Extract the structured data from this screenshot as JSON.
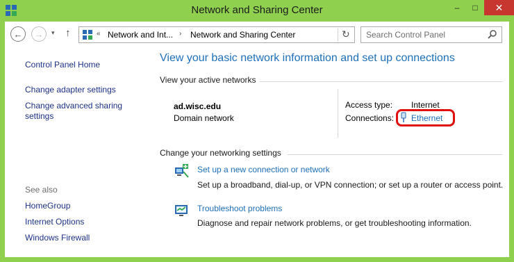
{
  "window": {
    "title": "Network and Sharing Center",
    "controls": {
      "minimize": "–",
      "maximize": "□",
      "close": "✕"
    }
  },
  "nav": {
    "back": "←",
    "forward": "→",
    "recent": "▾",
    "up": "↑",
    "breadcrumbs": [
      "Network and Int...",
      "Network and Sharing Center"
    ],
    "overflow": "«",
    "separator": "›",
    "refresh": "↻",
    "search_placeholder": "Search Control Panel"
  },
  "sidebar": {
    "links": [
      "Control Panel Home",
      "Change adapter settings",
      "Change advanced sharing settings"
    ],
    "see_also_heading": "See also",
    "see_also": [
      "HomeGroup",
      "Internet Options",
      "Windows Firewall"
    ]
  },
  "main": {
    "title": "View your basic network information and set up connections",
    "active_networks_label": "View your active networks",
    "network": {
      "name": "ad.wisc.edu",
      "category": "Domain network",
      "access_type_label": "Access type:",
      "access_type_value": "Internet",
      "connections_label": "Connections:",
      "connection_value": "Ethernet"
    },
    "change_settings_label": "Change your networking settings",
    "tasks": [
      {
        "link": "Set up a new connection or network",
        "desc": "Set up a broadband, dial-up, or VPN connection; or set up a router or access point.",
        "icon": "new-connection-icon"
      },
      {
        "link": "Troubleshoot problems",
        "desc": "Diagnose and repair network problems, or get troubleshooting information.",
        "icon": "troubleshoot-icon"
      }
    ]
  },
  "colors": {
    "frame": "#8fd14f",
    "link": "#1e6fb8",
    "highlight": "#e01010",
    "close": "#c7372f"
  }
}
